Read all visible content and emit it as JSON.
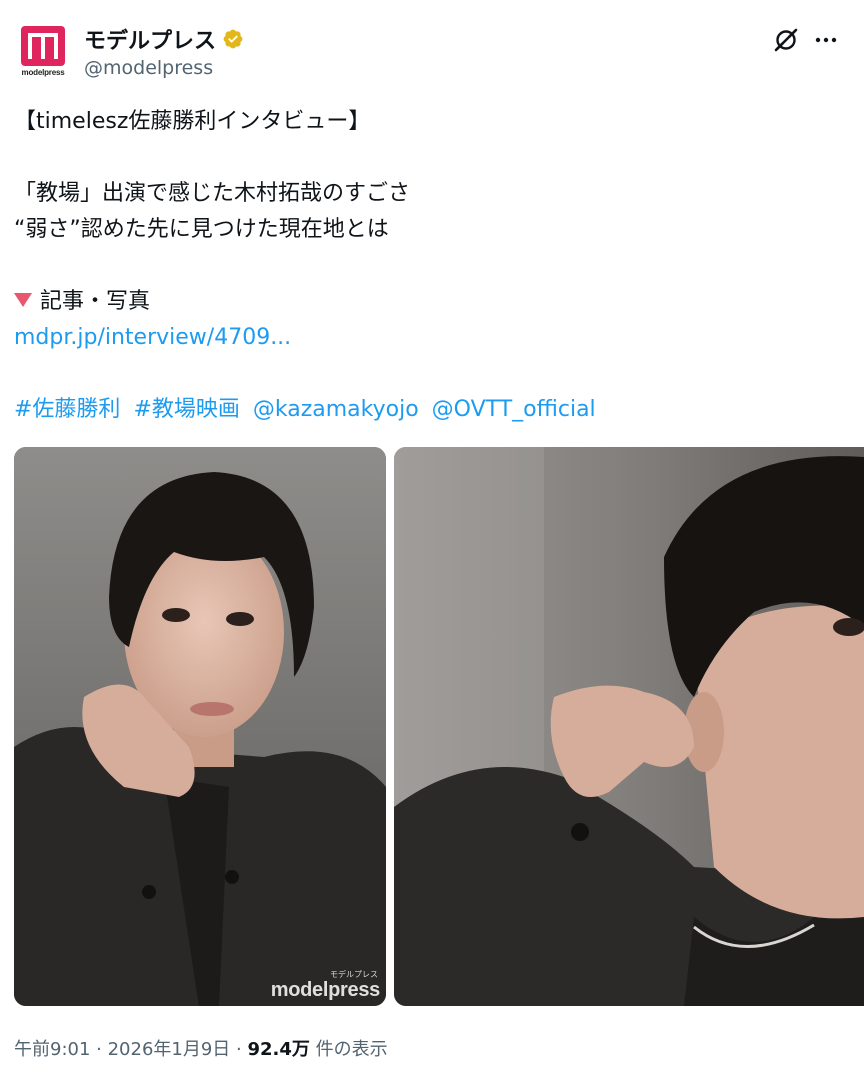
{
  "account": {
    "display_name": "モデルプレス",
    "handle": "@modelpress",
    "avatar_word": "modelpress",
    "verified_color": "#e2b719"
  },
  "icons": {
    "grok": "grok-icon",
    "more": "more-icon",
    "verified": "verified-badge-icon"
  },
  "tweet": {
    "line1": "【timelesz佐藤勝利インタビュー】",
    "line2": "「教場」出演で感じた木村拓哉のすごさ",
    "line3": "“弱さ”認めた先に見つけた現在地とは",
    "line4_label": "記事・写真",
    "link": "mdpr.jp/interview/4709...",
    "hashtags": [
      "#佐藤勝利",
      "#教場映画",
      "@kazamakyojo",
      "@OVTT_official"
    ]
  },
  "media": {
    "watermark": "modelpress",
    "watermark_small": "モデルプレス"
  },
  "meta": {
    "time": "午前9:01",
    "sep1": " · ",
    "date": "2026年1月9日",
    "sep2": " · ",
    "views": "92.4万",
    "views_label": " 件の表示"
  },
  "colors": {
    "link": "#1d9bf0",
    "secondary": "#536471",
    "brand": "#e0245e"
  }
}
